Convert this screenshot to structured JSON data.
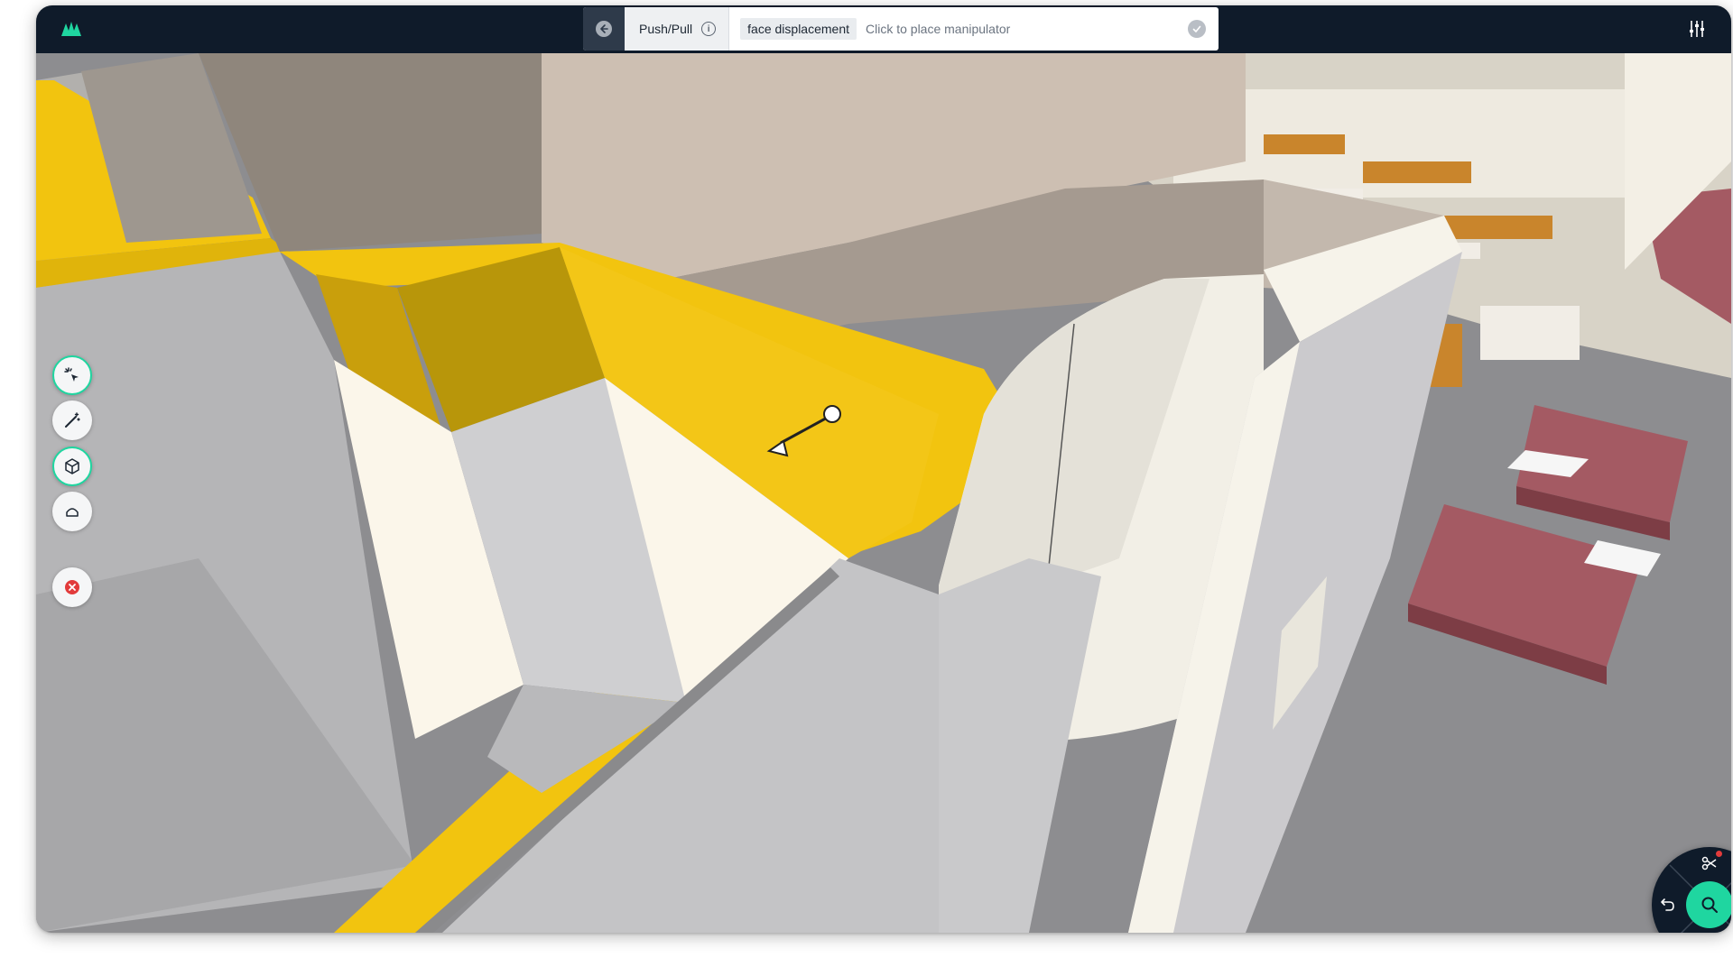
{
  "app": {
    "brand_color": "#1fd6a0",
    "logo_icon": "app-logo-icon",
    "settings_icon": "sliders-icon"
  },
  "command_bar": {
    "back_icon": "arrow-left-icon",
    "tool_label": "Push/Pull",
    "info_icon": "info-icon",
    "mode_label": "face displacement",
    "hint": "Click to place manipulator",
    "confirm_icon": "check-icon"
  },
  "left_toolbar": {
    "tools": [
      {
        "name": "select-tool",
        "icon": "cursor-sparkle-icon",
        "active": true
      },
      {
        "name": "magic-wand-tool",
        "icon": "magic-wand-icon",
        "active": false
      },
      {
        "name": "push-pull-tool",
        "icon": "cube-icon",
        "active": true
      },
      {
        "name": "eraser-tool",
        "icon": "eraser-icon",
        "active": false
      },
      {
        "name": "cancel-tool",
        "icon": "close-icon",
        "active": false
      }
    ]
  },
  "nav_wheel": {
    "top_icon": "scissors-icon",
    "left_icon": "undo-icon",
    "right_icon": "redo-icon",
    "bottom_icon": "eye-off-icon",
    "center_icon": "search-icon"
  },
  "colors": {
    "highlight": "#f2c40f",
    "highlight_dark": "#b8960a",
    "wall": "#c9c9cc",
    "floor": "#8f8f92",
    "topbar": "#0f1b2a"
  }
}
